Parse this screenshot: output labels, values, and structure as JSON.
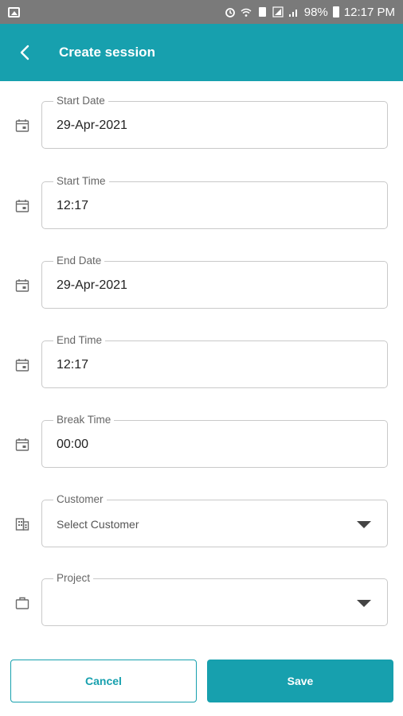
{
  "status_bar": {
    "battery": "98%",
    "time": "12:17 PM"
  },
  "app_bar": {
    "title": "Create session"
  },
  "fields": {
    "start_date": {
      "label": "Start Date",
      "value": "29-Apr-2021",
      "icon": "calendar-icon"
    },
    "start_time": {
      "label": "Start Time",
      "value": "12:17",
      "icon": "calendar-icon"
    },
    "end_date": {
      "label": "End Date",
      "value": "29-Apr-2021",
      "icon": "calendar-icon"
    },
    "end_time": {
      "label": "End Time",
      "value": "12:17",
      "icon": "calendar-icon"
    },
    "break_time": {
      "label": "Break Time",
      "value": "00:00",
      "icon": "calendar-icon"
    },
    "customer": {
      "label": "Customer",
      "placeholder": "Select Customer",
      "icon": "building-icon"
    },
    "project": {
      "label": "Project",
      "value": "",
      "icon": "briefcase-icon"
    }
  },
  "buttons": {
    "cancel": "Cancel",
    "save": "Save"
  },
  "colors": {
    "primary": "#17a0ae",
    "status_bar": "#7a7a7a"
  }
}
